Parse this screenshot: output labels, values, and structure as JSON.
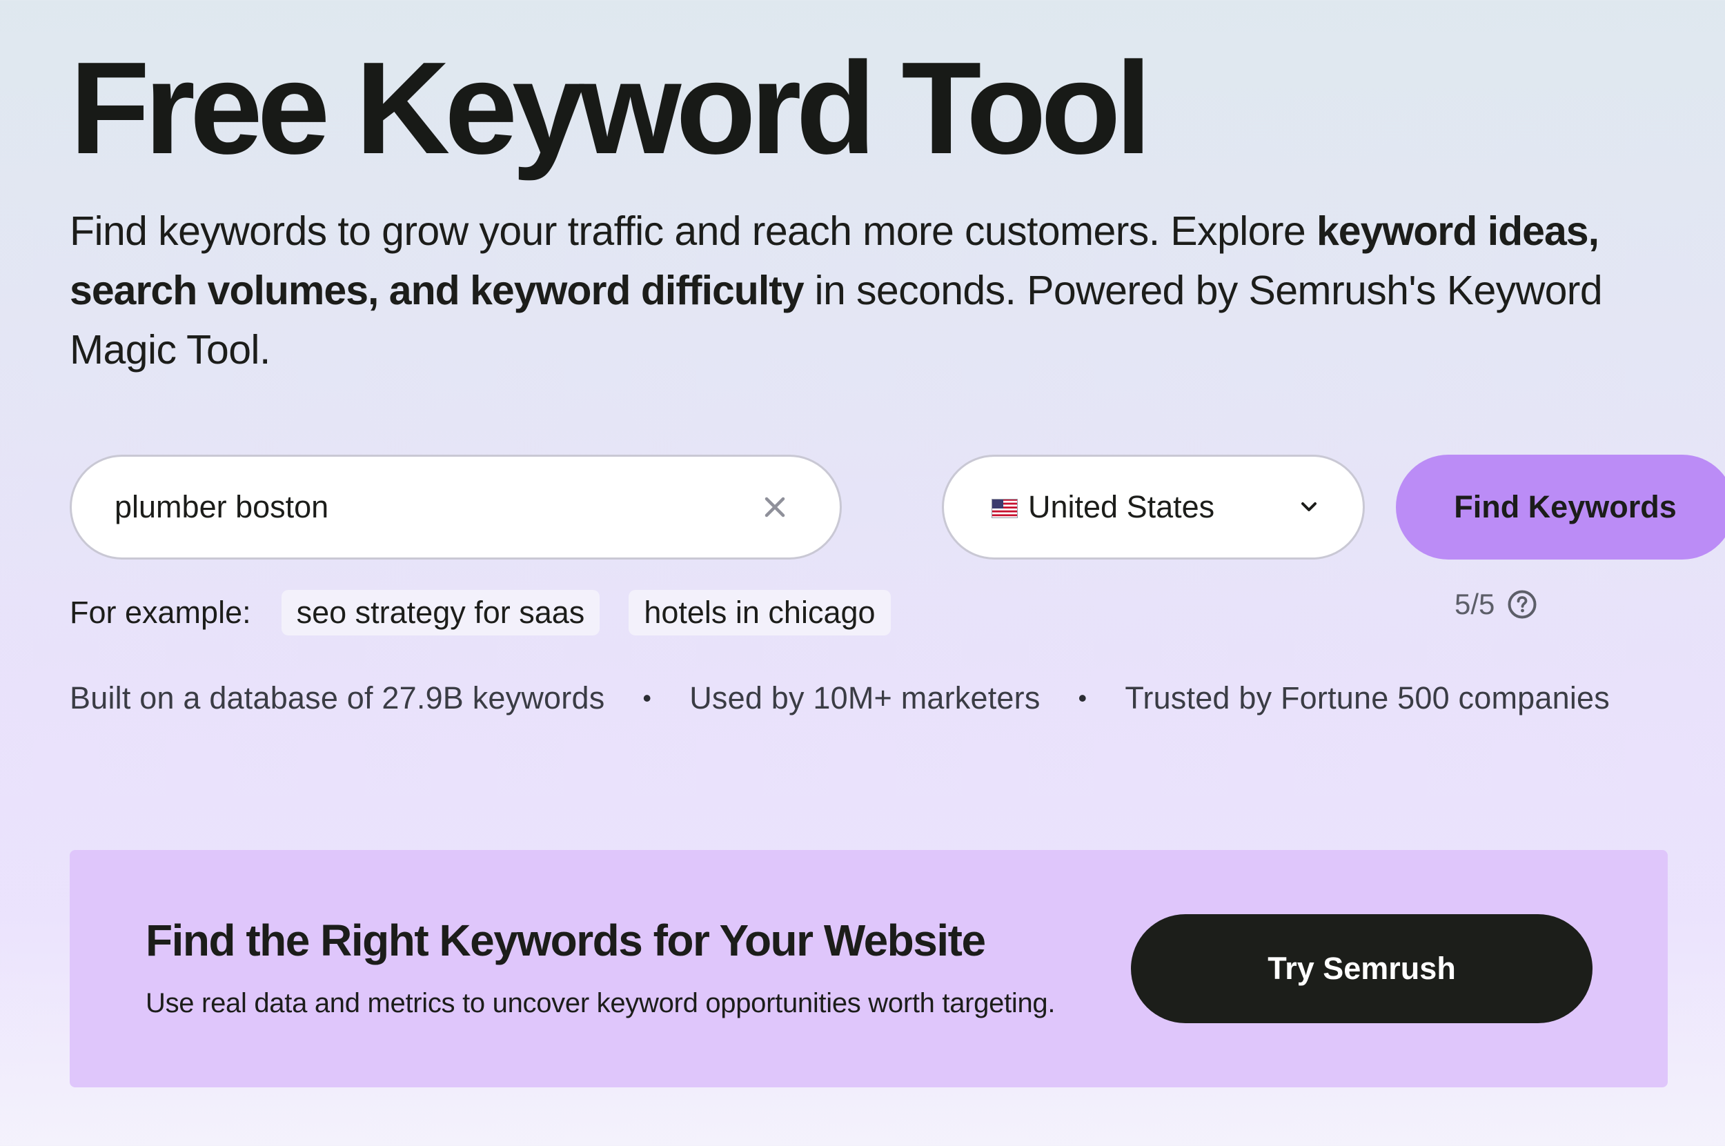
{
  "header": {
    "title": "Free Keyword Tool",
    "subtitle": {
      "part1": "Find keywords to grow your traffic and reach more customers. Explore ",
      "bold": "keyword ideas, search volumes, and keyword difficulty",
      "part2": " in seconds. Powered by Semrush's Keyword Magic Tool."
    }
  },
  "search": {
    "value": "plumber boston",
    "clear_icon": "close-icon"
  },
  "country": {
    "selected": "United States",
    "flag_icon": "us-flag-icon",
    "chevron_icon": "chevron-down-icon"
  },
  "find_button": {
    "label": "Find Keywords",
    "color": "#bb8cf6"
  },
  "usage": {
    "count": "5/5",
    "icon": "help-icon"
  },
  "examples": {
    "label": "For example:",
    "items": [
      "seo strategy for saas",
      "hotels in chicago"
    ]
  },
  "stats": [
    "Built on a database of 27.9B keywords",
    "Used by 10M+ marketers",
    "Trusted by Fortune 500 companies"
  ],
  "cta": {
    "title": "Find the Right Keywords for Your Website",
    "text": "Use real data and metrics to uncover keyword opportunities worth targeting.",
    "button_label": "Try Semrush",
    "background": "#dfc6fb"
  }
}
